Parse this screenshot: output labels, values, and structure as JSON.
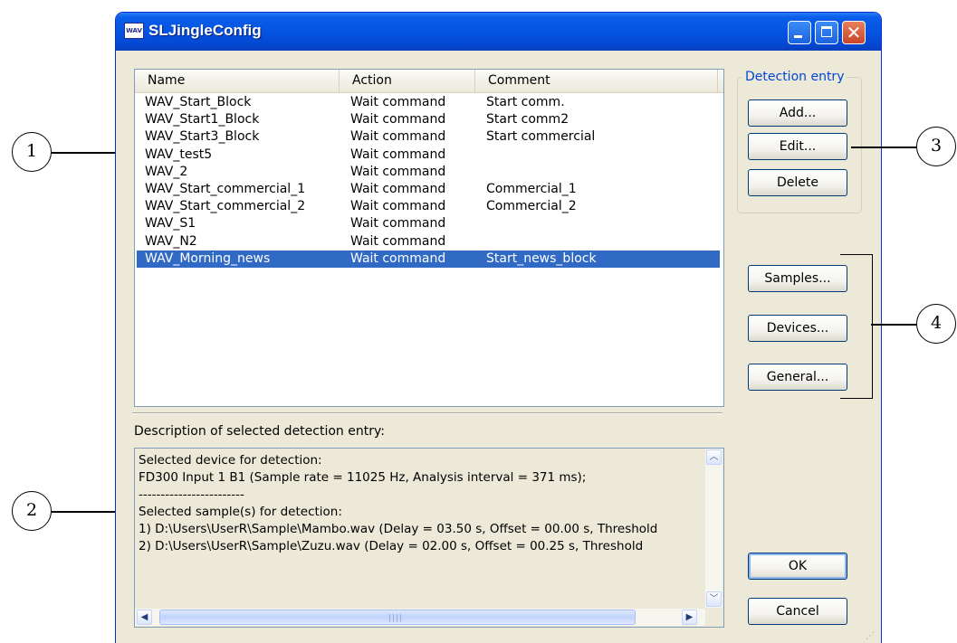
{
  "window": {
    "title": "SLJingleConfig",
    "icon_text": "WAV"
  },
  "list": {
    "columns": [
      "Name",
      "Action",
      "Comment"
    ],
    "rows": [
      {
        "name": "WAV_Start_Block",
        "action": "Wait command",
        "comment": "Start comm."
      },
      {
        "name": "WAV_Start1_Block",
        "action": "Wait command",
        "comment": "Start comm2"
      },
      {
        "name": "WAV_Start3_Block",
        "action": "Wait command",
        "comment": "Start commercial"
      },
      {
        "name": "WAV_test5",
        "action": "Wait command",
        "comment": ""
      },
      {
        "name": "WAV_2",
        "action": "Wait command",
        "comment": ""
      },
      {
        "name": "WAV_Start_commercial_1",
        "action": "Wait command",
        "comment": "Commercial_1"
      },
      {
        "name": "WAV_Start_commercial_2",
        "action": "Wait command",
        "comment": "Commercial_2"
      },
      {
        "name": "WAV_S1",
        "action": "Wait command",
        "comment": ""
      },
      {
        "name": "WAV_N2",
        "action": "Wait command",
        "comment": ""
      },
      {
        "name": "WAV_Morning_news",
        "action": "Wait command",
        "comment": "Start_news_block",
        "selected": true
      }
    ]
  },
  "description": {
    "label": "Description of selected detection entry:",
    "lines": [
      "Selected device for detection:",
      "FD300 Input 1 B1 (Sample rate = 11025 Hz, Analysis interval = 371 ms);",
      "------------------------",
      "Selected sample(s) for detection:",
      "1) D:\\Users\\UserR\\Sample\\Mambo.wav (Delay = 03.50 s, Offset = 00.00 s, Threshold",
      "2) D:\\Users\\UserR\\Sample\\Zuzu.wav (Delay = 02.00 s, Offset = 00.25 s, Threshold"
    ]
  },
  "detection_group": {
    "label": "Detection entry",
    "add": "Add...",
    "edit": "Edit...",
    "delete": "Delete"
  },
  "side_buttons": {
    "samples": "Samples...",
    "devices": "Devices...",
    "general": "General..."
  },
  "footer": {
    "ok": "OK",
    "cancel": "Cancel"
  },
  "callouts": [
    "1",
    "2",
    "3",
    "4"
  ],
  "colors": {
    "titlebar": "#0554e3",
    "selection": "#316ac5",
    "dialog": "#ece9d8",
    "group_label": "#0046d5",
    "close_button": "#c9442a"
  }
}
